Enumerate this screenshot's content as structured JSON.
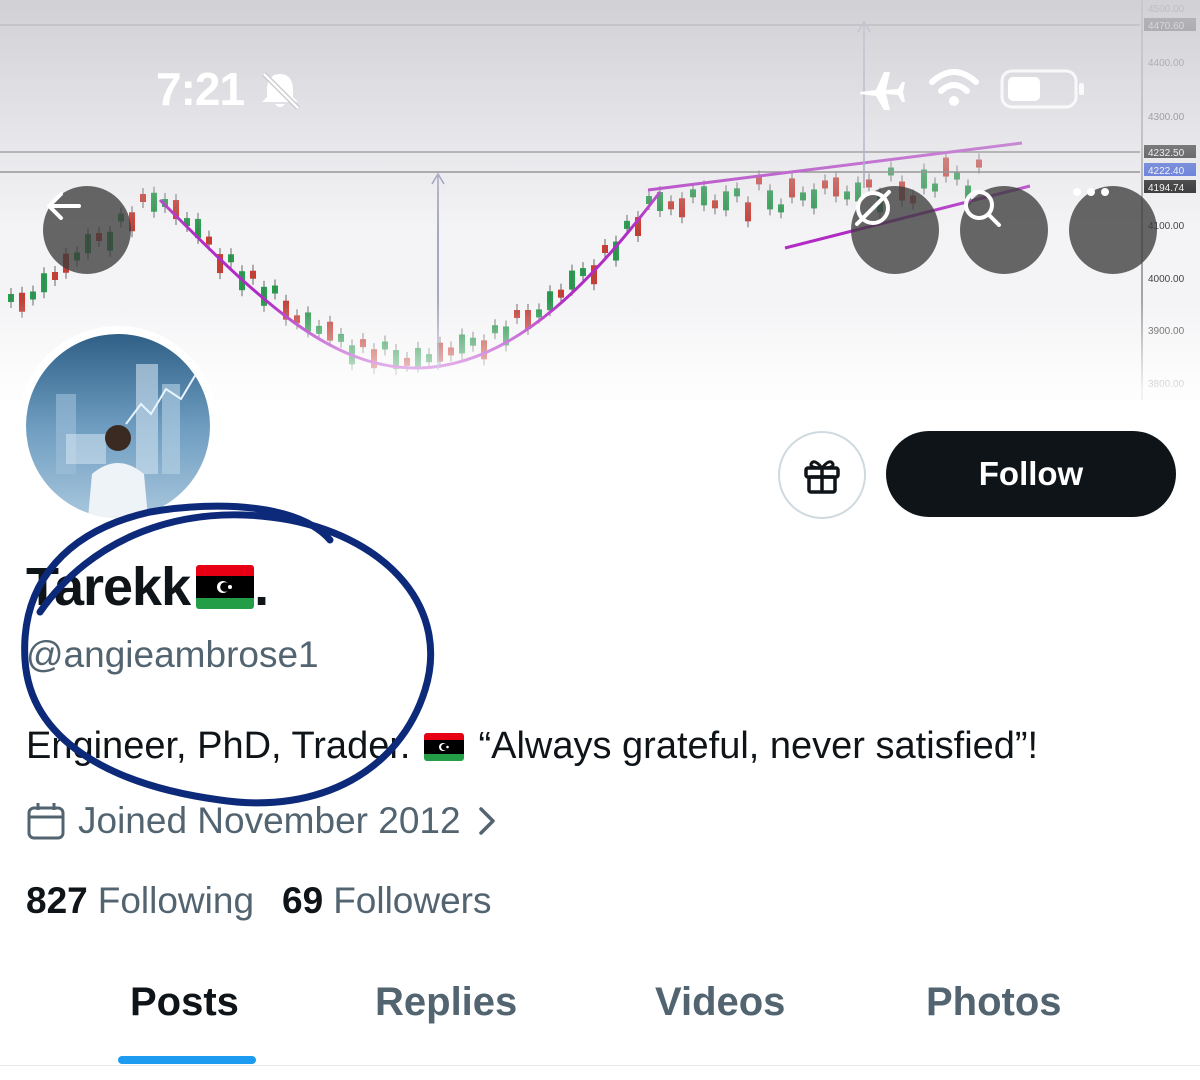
{
  "status_bar": {
    "time": "7:21"
  },
  "header": {
    "back_icon": "arrow-left-icon",
    "grok_icon": "grok-icon",
    "search_icon": "search-icon",
    "more_icon": "more-icon"
  },
  "banner": {
    "price_labels": [
      "4500.00",
      "4470.60",
      "4400.00",
      "4300.00",
      "4232.50",
      "4222.40",
      "4194.74",
      "4100.00",
      "4000.00",
      "3900.00",
      "3800.00"
    ]
  },
  "actions": {
    "gift_icon": "gift-icon",
    "follow_label": "Follow"
  },
  "profile": {
    "display_name": "Tarekk",
    "display_name_suffix": ".",
    "handle": "@angieambrose1",
    "bio_part1": "Engineer, PhD, Trader.",
    "bio_part2": "“Always grateful, never satisfied”!",
    "joined": "Joined November 2012"
  },
  "stats": {
    "following_count": "827",
    "following_label": "Following",
    "followers_count": "69",
    "followers_label": "Followers"
  },
  "tabs": [
    {
      "label": "Posts",
      "active": true
    },
    {
      "label": "Replies",
      "active": false
    },
    {
      "label": "Videos",
      "active": false
    },
    {
      "label": "Photos",
      "active": false
    }
  ],
  "colors": {
    "accent": "#1d9bf0",
    "text_primary": "#0f1419",
    "text_secondary": "#536471",
    "annotation": "#0d2a7a",
    "chart_curve": "#b02cc4",
    "candle_up": "#1fa34a",
    "candle_down": "#d9362b"
  }
}
